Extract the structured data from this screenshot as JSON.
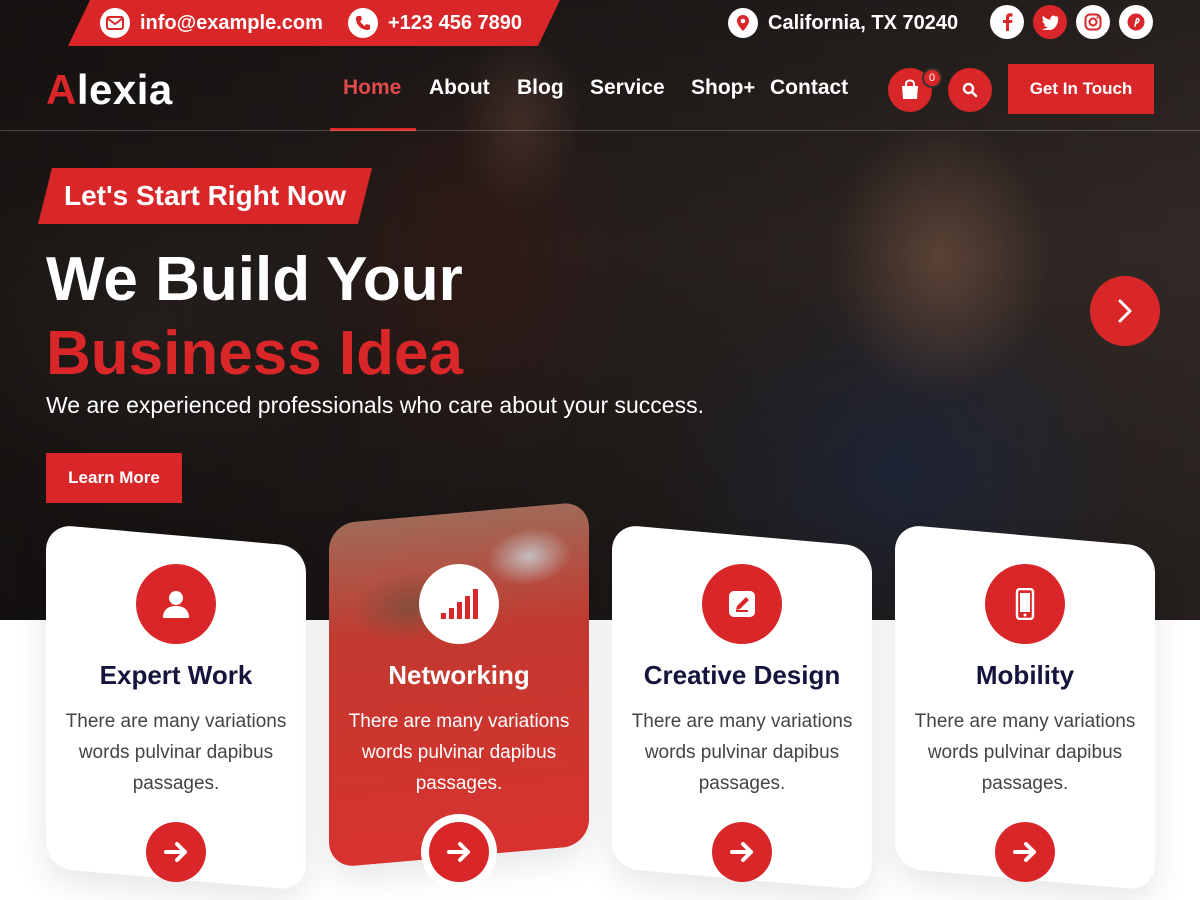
{
  "topbar": {
    "email": "info@example.com",
    "phone": "+123 456 7890",
    "location": "California, TX 70240",
    "socials": [
      "facebook-icon",
      "twitter-icon",
      "instagram-icon",
      "pinterest-icon"
    ]
  },
  "header": {
    "logo_first": "A",
    "logo_rest": "lexia",
    "nav": [
      "Home",
      "About",
      "Blog",
      "Service",
      "Shop",
      "Contact"
    ],
    "shop_plus": "+",
    "cart_count": "0",
    "cta": "Get In Touch"
  },
  "hero": {
    "tagline": "Let's Start Right Now",
    "headline_1": "We Build Your",
    "headline_2": "Business Idea",
    "subheadline": "We are experienced professionals who care about your success.",
    "button": "Learn More"
  },
  "services": [
    {
      "title": "Expert Work",
      "text": "There are many variations words pulvinar dapibus passages.",
      "icon": "user-icon"
    },
    {
      "title": "Networking",
      "text": "There are many variations words pulvinar dapibus passages.",
      "icon": "bar-chart-icon"
    },
    {
      "title": "Creative Design",
      "text": "There are many variations words pulvinar dapibus passages.",
      "icon": "edit-icon"
    },
    {
      "title": "Mobility",
      "text": "There are many variations words pulvinar dapibus passages.",
      "icon": "mobile-icon"
    }
  ],
  "colors": {
    "accent": "#d92628",
    "heading_dark": "#14143c",
    "body_text": "#444444"
  }
}
